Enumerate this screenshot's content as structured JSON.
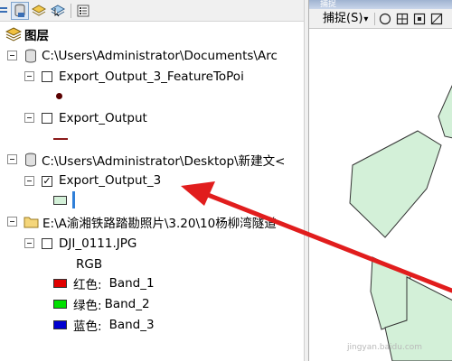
{
  "toc": {
    "root_label": "图层",
    "groups": [
      {
        "path": "C:\\Users\\Administrator\\Documents\\Arc",
        "layers": [
          {
            "name": "Export_Output_3_FeatureToPoi",
            "checked": false,
            "symbol": "point",
            "color": "#5a0000"
          },
          {
            "name": "Export_Output",
            "checked": false,
            "symbol": "line",
            "color": "#8b1a1a"
          }
        ]
      },
      {
        "path": "C:\\Users\\Administrator\\Desktop\\新建文<",
        "layers": [
          {
            "name": "Export_Output_3",
            "checked": true,
            "symbol": "polygon",
            "color": "#d3f0d8"
          }
        ]
      },
      {
        "path": "E:\\A渝湘铁路踏勘照片\\3.20\\10杨柳湾隧道",
        "layers": [
          {
            "name": "DJI_0111.JPG",
            "checked": false,
            "renderer": "RGB",
            "bands": [
              {
                "label": "红色:",
                "band": "Band_1",
                "color": "#e00000"
              },
              {
                "label": "绿色:",
                "band": "Band_2",
                "color": "#00e000"
              },
              {
                "label": "蓝色:",
                "band": "Band_3",
                "color": "#0000d0"
              }
            ]
          }
        ]
      }
    ]
  },
  "snapping": {
    "title": "捕捉",
    "menu_label": "捕捉(S)",
    "menu_arrow": "▾",
    "tools": [
      "point-snap-icon",
      "end-snap-icon",
      "vertex-snap-icon",
      "edge-snap-icon"
    ]
  },
  "map": {
    "polygon_fill": "#d3f0d8",
    "polygon_stroke": "#333333"
  },
  "annotation": {
    "arrow_color": "#e11d1d"
  },
  "watermark": "jingyan.baidu.com"
}
